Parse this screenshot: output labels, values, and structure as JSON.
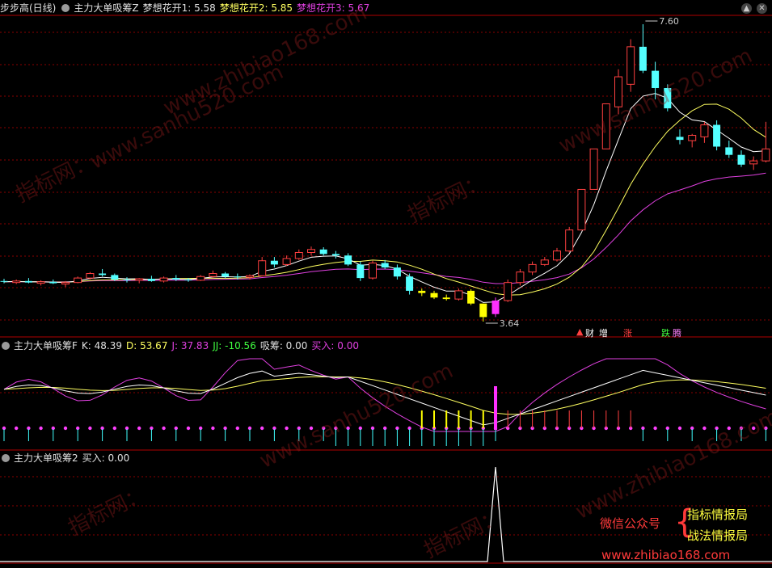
{
  "header1": {
    "items": [
      {
        "text": "步步高(日线)",
        "color": "#e0e0e0"
      },
      {
        "text": "主力大单吸筹Z",
        "color": "#e0e0e0"
      },
      {
        "text": "梦想花开1: 5.58",
        "color": "#e0e0e0"
      },
      {
        "text": "梦想花开2: 5.85",
        "color": "#ffff60"
      },
      {
        "text": "梦想花开3: 5.67",
        "color": "#e040e0"
      }
    ]
  },
  "header2": {
    "items": [
      {
        "text": "主力大单吸筹F",
        "color": "#e0e0e0"
      },
      {
        "text": "K: 48.39",
        "color": "#e0e0e0"
      },
      {
        "text": "D: 53.67",
        "color": "#ffff60"
      },
      {
        "text": "J: 37.83",
        "color": "#e040e0"
      },
      {
        "text": "JJ: -10.56",
        "color": "#40ff40"
      },
      {
        "text": "吸筹: 0.00",
        "color": "#e0e0e0"
      },
      {
        "text": "买入: 0.00",
        "color": "#e040e0"
      }
    ]
  },
  "header3": {
    "items": [
      {
        "text": "主力大单吸筹2",
        "color": "#e0e0e0"
      },
      {
        "text": "买入: 0.00",
        "color": "#e0e0e0"
      }
    ]
  },
  "signals": {
    "cai": "财",
    "zeng": "增",
    "zhang": "涨",
    "die": "跌",
    "teng": "腾"
  },
  "promo": {
    "label": "微信公众号",
    "line1": "指标情报局",
    "line2": "战法情报局",
    "site": "www.zhibiao168.com"
  },
  "watermarks": [
    "www.zhibiao168.com",
    "指标网：",
    "www.sanhu520.com"
  ],
  "colors": {
    "up": "#ff4040",
    "down": "#54ffff",
    "ma1": "#ffffff",
    "ma2": "#ffff60",
    "ma3": "#e040e0",
    "grid": "#8a0000",
    "absorb": "#ffff00",
    "buy": "#ff30ff"
  },
  "chart_data": [
    {
      "type": "candlestick",
      "title": "步步高(日线)",
      "annotations": [
        {
          "text": "7.60",
          "value": 7.6
        },
        {
          "text": "3.64",
          "value": 3.64
        }
      ],
      "ohlc": [
        [
          4.18,
          4.21,
          4.15,
          4.17
        ],
        [
          4.16,
          4.2,
          4.14,
          4.18
        ],
        [
          4.18,
          4.22,
          4.15,
          4.16
        ],
        [
          4.15,
          4.19,
          4.12,
          4.17
        ],
        [
          4.17,
          4.2,
          4.14,
          4.15
        ],
        [
          4.14,
          4.18,
          4.1,
          4.16
        ],
        [
          4.16,
          4.24,
          4.15,
          4.22
        ],
        [
          4.22,
          4.3,
          4.2,
          4.28
        ],
        [
          4.28,
          4.34,
          4.24,
          4.26
        ],
        [
          4.26,
          4.28,
          4.18,
          4.2
        ],
        [
          4.2,
          4.23,
          4.16,
          4.19
        ],
        [
          4.19,
          4.22,
          4.15,
          4.21
        ],
        [
          4.21,
          4.25,
          4.17,
          4.18
        ],
        [
          4.18,
          4.24,
          4.16,
          4.22
        ],
        [
          4.22,
          4.26,
          4.18,
          4.2
        ],
        [
          4.2,
          4.22,
          4.17,
          4.19
        ],
        [
          4.19,
          4.26,
          4.18,
          4.24
        ],
        [
          4.24,
          4.32,
          4.22,
          4.28
        ],
        [
          4.28,
          4.3,
          4.22,
          4.24
        ],
        [
          4.24,
          4.28,
          4.2,
          4.23
        ],
        [
          4.23,
          4.27,
          4.2,
          4.25
        ],
        [
          4.25,
          4.5,
          4.24,
          4.45
        ],
        [
          4.45,
          4.5,
          4.36,
          4.4
        ],
        [
          4.4,
          4.52,
          4.38,
          4.48
        ],
        [
          4.48,
          4.6,
          4.46,
          4.56
        ],
        [
          4.56,
          4.64,
          4.52,
          4.6
        ],
        [
          4.6,
          4.63,
          4.52,
          4.54
        ],
        [
          4.54,
          4.58,
          4.48,
          4.52
        ],
        [
          4.52,
          4.55,
          4.38,
          4.4
        ],
        [
          4.4,
          4.44,
          4.18,
          4.22
        ],
        [
          4.22,
          4.45,
          4.2,
          4.42
        ],
        [
          4.42,
          4.46,
          4.34,
          4.36
        ],
        [
          4.36,
          4.4,
          4.2,
          4.24
        ],
        [
          4.24,
          4.28,
          4.0,
          4.05
        ],
        [
          4.05,
          4.08,
          3.98,
          4.02
        ],
        [
          4.02,
          4.05,
          3.94,
          3.96
        ],
        [
          3.96,
          4.0,
          3.92,
          3.94
        ],
        [
          3.94,
          4.08,
          3.92,
          4.05
        ],
        [
          4.05,
          4.07,
          3.86,
          3.88
        ],
        [
          3.88,
          3.88,
          3.64,
          3.7
        ],
        [
          3.74,
          3.96,
          3.7,
          3.92
        ],
        [
          3.92,
          4.2,
          3.9,
          4.16
        ],
        [
          4.16,
          4.34,
          4.12,
          4.3
        ],
        [
          4.3,
          4.44,
          4.26,
          4.4
        ],
        [
          4.4,
          4.5,
          4.38,
          4.46
        ],
        [
          4.46,
          4.62,
          4.44,
          4.58
        ],
        [
          4.58,
          4.9,
          4.56,
          4.86
        ],
        [
          4.86,
          5.4,
          4.86,
          5.4
        ],
        [
          5.4,
          5.94,
          5.4,
          5.94
        ],
        [
          5.94,
          6.54,
          5.94,
          6.54
        ],
        [
          6.5,
          7.0,
          6.4,
          6.9
        ],
        [
          6.8,
          7.4,
          6.7,
          7.3
        ],
        [
          7.3,
          7.6,
          6.95,
          6.98
        ],
        [
          6.98,
          7.1,
          6.6,
          6.75
        ],
        [
          6.75,
          6.8,
          6.44,
          6.48
        ],
        [
          6.1,
          6.2,
          6.0,
          6.06
        ],
        [
          6.05,
          6.14,
          5.96,
          6.12
        ],
        [
          6.1,
          6.3,
          6.02,
          6.26
        ],
        [
          6.26,
          6.32,
          5.92,
          5.97
        ],
        [
          5.96,
          6.05,
          5.82,
          5.86
        ],
        [
          5.86,
          5.92,
          5.7,
          5.73
        ],
        [
          5.74,
          5.84,
          5.66,
          5.78
        ],
        [
          5.78,
          6.3,
          5.76,
          5.94
        ]
      ],
      "series": [
        {
          "name": "梦想花开1",
          "last": 5.58
        },
        {
          "name": "梦想花开2",
          "last": 5.85
        },
        {
          "name": "梦想花开3",
          "last": 5.67
        }
      ]
    },
    {
      "type": "line",
      "title": "主力大单吸筹F",
      "series": [
        {
          "name": "K",
          "last": 48.39
        },
        {
          "name": "D",
          "last": 53.67
        },
        {
          "name": "J",
          "last": 37.83
        },
        {
          "name": "JJ",
          "last": -10.56
        },
        {
          "name": "吸筹",
          "last": 0.0
        },
        {
          "name": "买入",
          "last": 0.0
        }
      ]
    },
    {
      "type": "line",
      "title": "主力大单吸筹2",
      "series": [
        {
          "name": "买入",
          "last": 0.0,
          "peak_index": 40
        }
      ]
    }
  ]
}
